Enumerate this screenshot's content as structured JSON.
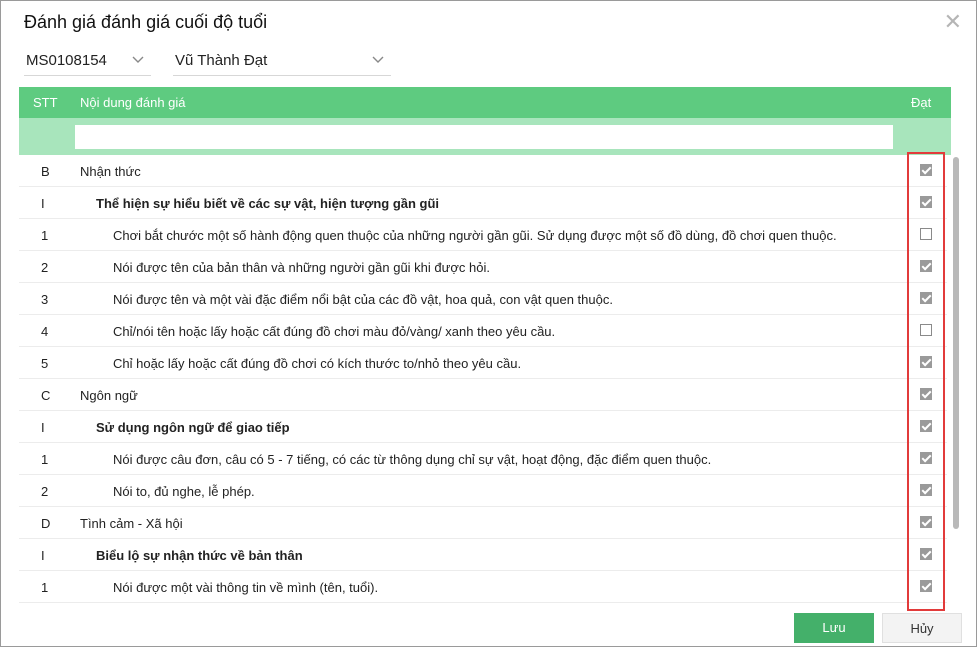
{
  "dialog": {
    "title": "Đánh giá đánh giá cuối độ tuổi",
    "close_label": "✕"
  },
  "filters": {
    "student_id": "MS0108154",
    "student_name": "Vũ Thành Đạt"
  },
  "table": {
    "headers": {
      "stt": "STT",
      "content": "Nội dung đánh giá",
      "pass": "Đạt"
    },
    "filter_placeholder": "",
    "rows": [
      {
        "stt": "B",
        "content": "Nhận thức",
        "level": 0,
        "checked": true
      },
      {
        "stt": "I",
        "content": "Thể hiện sự hiểu biết về các sự vật, hiện tượng gần gũi",
        "level": 1,
        "checked": true
      },
      {
        "stt": "1",
        "content": "Chơi bắt chước một số hành động quen thuộc của những người gần gũi. Sử dụng được một số đồ dùng, đồ chơi quen thuộc.",
        "level": 2,
        "checked": false
      },
      {
        "stt": "2",
        "content": " Nói được tên của bản thân và những người gần gũi khi được hỏi.",
        "level": 2,
        "checked": true
      },
      {
        "stt": "3",
        "content": "Nói được tên và một vài đặc điểm nổi bật của các đồ vật, hoa quả, con vật quen thuộc.",
        "level": 2,
        "checked": true
      },
      {
        "stt": "4",
        "content": "Chỉ/nói tên hoặc lấy hoặc cất đúng đồ chơi màu đỏ/vàng/ xanh theo yêu cầu.",
        "level": 2,
        "checked": false
      },
      {
        "stt": "5",
        "content": "Chỉ hoặc lấy hoặc cất đúng đồ chơi có kích thước to/nhỏ theo yêu cầu.",
        "level": 2,
        "checked": true
      },
      {
        "stt": "C",
        "content": "Ngôn ngữ",
        "level": 0,
        "checked": true
      },
      {
        "stt": "I",
        "content": "Sử dụng ngôn ngữ để giao tiếp",
        "level": 1,
        "checked": true
      },
      {
        "stt": "1",
        "content": "Nói được câu đơn, câu có 5 - 7 tiếng, có các từ thông dụng chỉ sự vật, hoạt động, đặc điểm quen thuộc.",
        "level": 2,
        "checked": true
      },
      {
        "stt": "2",
        "content": "Nói to, đủ nghe, lễ phép.",
        "level": 2,
        "checked": true
      },
      {
        "stt": "D",
        "content": "Tình cảm - Xã hội",
        "level": 0,
        "checked": true
      },
      {
        "stt": "I",
        "content": "Biểu lộ sự nhận thức về bản thân",
        "level": 1,
        "checked": true
      },
      {
        "stt": "1",
        "content": "Nói được một vài thông tin về mình (tên, tuổi).",
        "level": 2,
        "checked": true
      }
    ]
  },
  "buttons": {
    "save": "Lưu",
    "cancel": "Hủy"
  },
  "colors": {
    "header": "#5ecb80",
    "filter_row": "#a8e5bc",
    "save": "#44b06a",
    "highlight": "#e23b3b"
  }
}
